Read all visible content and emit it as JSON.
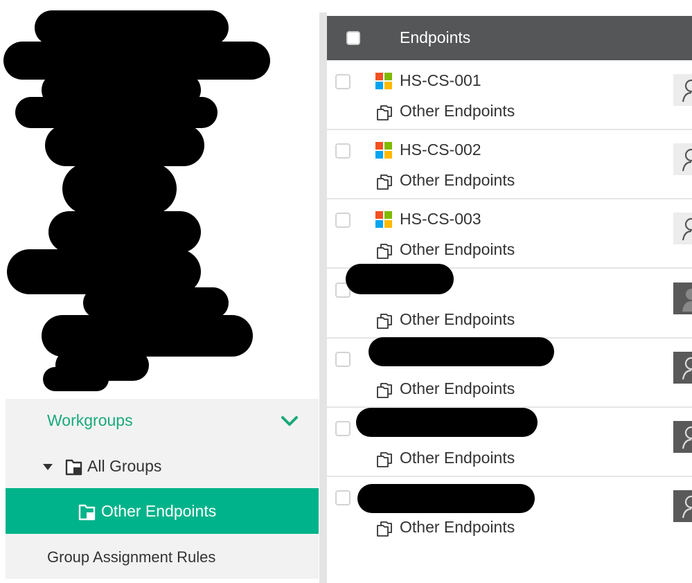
{
  "nav": {
    "workgroups_label": "Workgroups",
    "all_groups_label": "All Groups",
    "other_endpoints_label": "Other Endpoints",
    "group_rules_label": "Group Assignment Rules"
  },
  "table": {
    "header_title": "Endpoints",
    "rows": [
      {
        "name": "HS-CS-001",
        "group": "Other Endpoints"
      },
      {
        "name": "HS-CS-002",
        "group": "Other Endpoints"
      },
      {
        "name": "HS-CS-003",
        "group": "Other Endpoints"
      },
      {
        "name": "",
        "group": "Other Endpoints"
      },
      {
        "name": "",
        "group": "Other Endpoints"
      },
      {
        "name": "",
        "group": "Other Endpoints"
      },
      {
        "name": "",
        "group": "Other Endpoints"
      }
    ]
  },
  "colors": {
    "accent": "#00b38a",
    "accent_text": "#19a97b",
    "header_bg": "#555657",
    "nav_bg": "#f2f2f2"
  },
  "icons": {
    "os": "windows-icon",
    "group": "group-folder-icon",
    "user": "user-icon",
    "chevron": "chevron-down-icon",
    "caret": "caret-down-icon"
  }
}
